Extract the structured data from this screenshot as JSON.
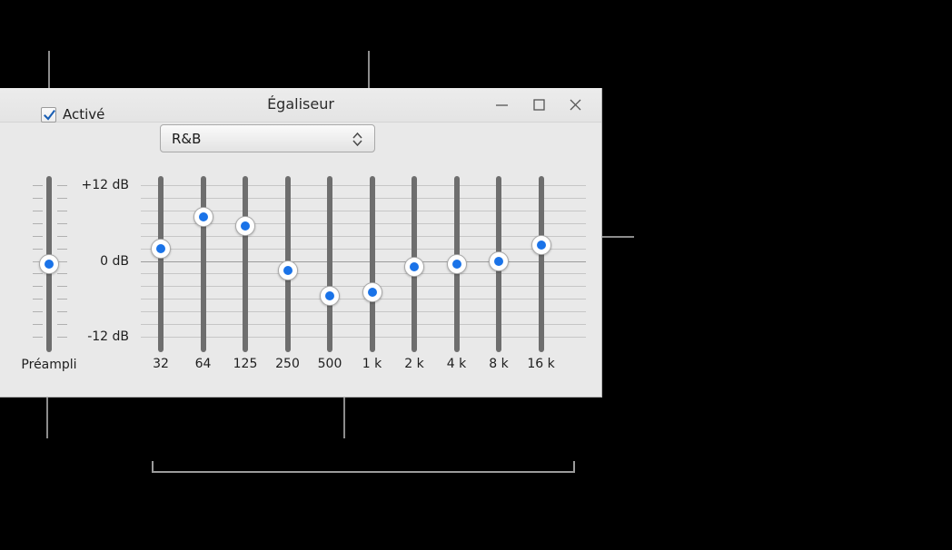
{
  "window": {
    "title": "Égaliseur",
    "buttons": {
      "minimize": "minimize-button",
      "maximize": "maximize-button",
      "close": "close-button"
    }
  },
  "controls": {
    "enabled_label": "Activé",
    "enabled_checked": true,
    "preset_value": "R&B"
  },
  "scale": {
    "top_label": "+12 dB",
    "mid_label": "0 dB",
    "bottom_label": "-12 dB"
  },
  "preamp": {
    "label": "Préampli",
    "value_db": 0
  },
  "chart_data": {
    "type": "bar",
    "title": "Égaliseur — R&B",
    "xlabel": "",
    "ylabel": "dB",
    "ylim": [
      -12,
      12
    ],
    "categories": [
      "32",
      "64",
      "125",
      "250",
      "500",
      "1 k",
      "2 k",
      "4 k",
      "8 k",
      "16 k"
    ],
    "values": [
      2,
      7,
      5.5,
      -1.5,
      -5.5,
      -5,
      -1,
      -0.5,
      0,
      2.5
    ],
    "tick_labels": [
      "+12 dB",
      "0 dB",
      "-12 dB"
    ],
    "grid": true,
    "legend": "none"
  },
  "accent_color": "#1a73e8"
}
